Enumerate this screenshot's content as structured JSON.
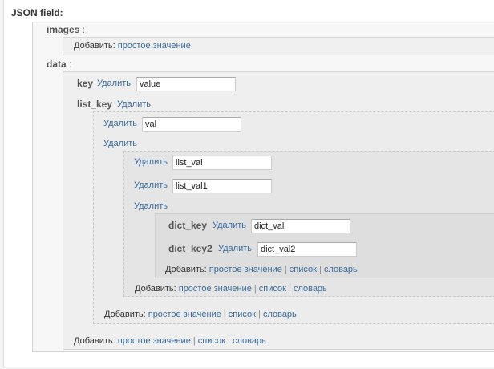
{
  "field": {
    "label": "JSON field:"
  },
  "labels": {
    "add": "Добавить:",
    "simple": "простое значение",
    "list": "список",
    "dict": "словарь",
    "remove": "Удалить",
    "sep": "|",
    "colon": ":"
  },
  "images": {
    "key": "images"
  },
  "data": {
    "key": "data",
    "key_item": {
      "key": "key",
      "value": "value"
    },
    "list_key": {
      "key": "list_key",
      "item1": {
        "value": "val"
      },
      "nested_list": {
        "item1": {
          "value": "list_val"
        },
        "item2": {
          "value": "list_val1"
        },
        "dict": {
          "dict_key": {
            "key": "dict_key",
            "value": "dict_val"
          },
          "dict_key2": {
            "key": "dict_key2",
            "value": "dict_val2"
          }
        }
      }
    }
  }
}
